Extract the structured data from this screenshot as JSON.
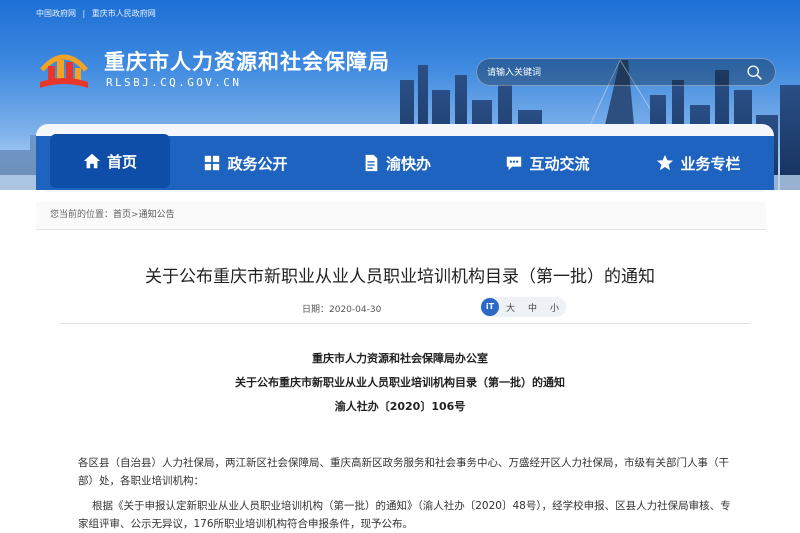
{
  "header": {
    "top_links": [
      "中国政府网",
      "|",
      "重庆市人民政府网"
    ],
    "site_title": "重庆市人力资源和社会保障局",
    "site_domain": "RLSBJ.CQ.GOV.CN",
    "search": {
      "placeholder": "请输入关键词",
      "icon": "search-icon"
    }
  },
  "nav": {
    "items": [
      {
        "label": "首页",
        "icon": "home-icon",
        "active": true
      },
      {
        "label": "政务公开",
        "icon": "grid-icon"
      },
      {
        "label": "渝快办",
        "icon": "document-icon"
      },
      {
        "label": "互动交流",
        "icon": "chat-icon"
      },
      {
        "label": "业务专栏",
        "icon": "star-icon"
      }
    ]
  },
  "breadcrumb": {
    "prefix": "您当前的位置：",
    "home": "首页",
    "sep": ">",
    "current": "通知公告"
  },
  "article": {
    "title": "关于公布重庆市新职业从业人员职业培训机构目录（第一批）的通知",
    "date_label": "日期：2020-04-30",
    "font_sizes": [
      "大",
      "中",
      "小"
    ],
    "font_icon_text": "iT",
    "issuer": "重庆市人力资源和社会保障局办公室",
    "doc_title": "关于公布重庆市新职业从业人员职业培训机构目录（第一批）的通知",
    "doc_number": "渝人社办〔2020〕106号",
    "paragraphs": [
      "各区县（自治县）人力社保局，两江新区社会保障局、重庆高新区政务服务和社会事务中心、万盛经开区人力社保局，市级有关部门人事（干部）处，各职业培训机构：",
      "根据《关于申报认定新职业从业人员职业培训机构（第一批）的通知》（渝人社办〔2020〕48号），经学校申报、区县人力社保局审核、专家组评审、公示无异议，176所职业培训机构符合申报条件，现予公布。"
    ]
  },
  "colors": {
    "nav_bg": "#1f63c0",
    "nav_active": "#0f4ea8",
    "banner_top": "#1d6fd4"
  }
}
